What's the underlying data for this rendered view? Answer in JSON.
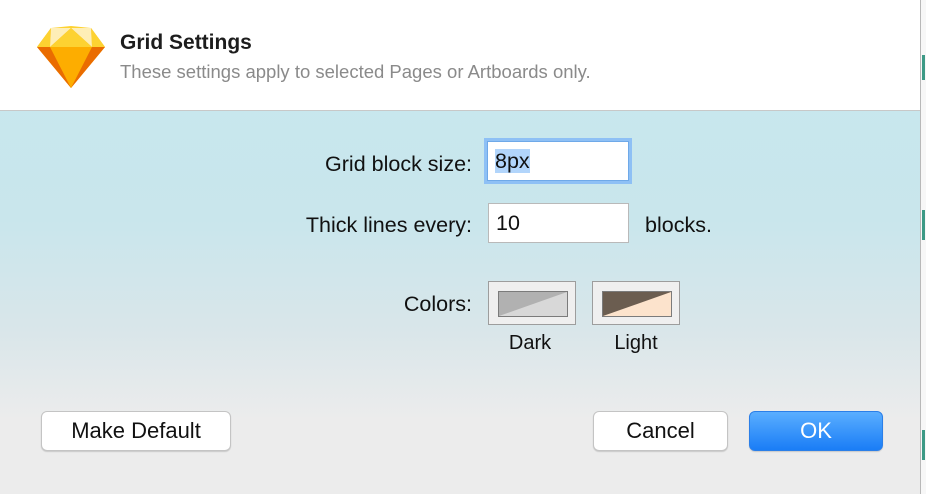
{
  "dialog": {
    "title": "Grid Settings",
    "subtitle": "These settings apply to selected Pages or Artboards only.",
    "app_icon": "sketch-diamond-icon"
  },
  "form": {
    "grid_block_size": {
      "label": "Grid block size:",
      "value": "8px",
      "selected": true
    },
    "thick_lines": {
      "label": "Thick lines every:",
      "value": "10",
      "suffix": "blocks."
    },
    "colors": {
      "label": "Colors:",
      "dark": {
        "label": "Dark",
        "color_a": "#b1b1b1",
        "color_b": "#d8d8d8",
        "border": "#7b7b7b"
      },
      "light": {
        "label": "Light",
        "color_a": "#6b5d50",
        "color_b": "#fce3cc",
        "border": "#7b7b7b"
      }
    }
  },
  "buttons": {
    "make_default": "Make Default",
    "cancel": "Cancel",
    "ok": "OK"
  },
  "colors": {
    "accent": "#1a7df6",
    "header_bg": "#ffffff",
    "body_bg_top": "#c6e8ef",
    "body_bg_bottom": "#ececec",
    "focus_ring": "#8ec0f5",
    "text_selection": "#b2d5fb"
  }
}
